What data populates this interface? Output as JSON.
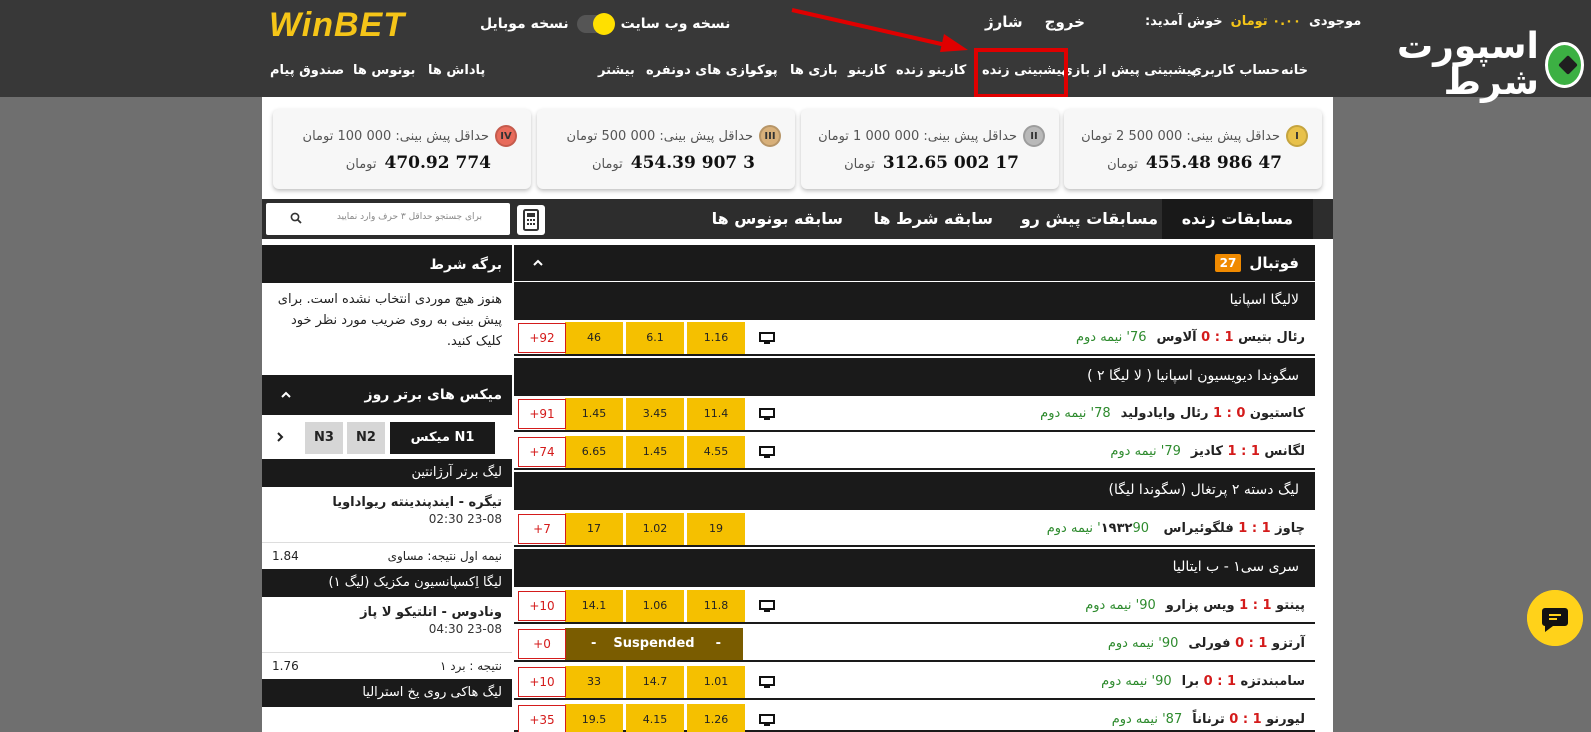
{
  "header": {
    "logo": "WinBET",
    "mobile_version": "نسخه موبایل",
    "web_version": "نسخه وب سایت",
    "logout": "خروج",
    "charge": "شارژ",
    "welcome": "خوش آمدید:",
    "balance_label": "موجودی",
    "balance_amount": "۰.۰۰ تومان",
    "brand_text": "اسپورت شرط"
  },
  "nav": [
    {
      "label": "خانه"
    },
    {
      "label": "حساب کاربری"
    },
    {
      "label": "پیشبینی پیش از بازی"
    },
    {
      "label": "پیشبینی زنده"
    },
    {
      "label": "کازینو زنده"
    },
    {
      "label": "کازینو"
    },
    {
      "label": "بازی ها"
    },
    {
      "label": "پوکر"
    },
    {
      "label": "بازی های دونفره"
    },
    {
      "label": "بیشتر"
    },
    {
      "label": "پاداش ها"
    },
    {
      "label": "بونوس ها"
    },
    {
      "label": "صندوق پیام"
    }
  ],
  "jackpots": [
    {
      "medal": "I",
      "medal_color": "#e8c14a",
      "min": "حداقل پیش بینی: 000 500 2 تومان",
      "amount": "47 986 455.48",
      "unit": "تومان"
    },
    {
      "medal": "II",
      "medal_color": "#b9b9b9",
      "min": "حداقل پیش بینی: 000 000 1 تومان",
      "amount": "17 002 312.65",
      "unit": "تومان"
    },
    {
      "medal": "III",
      "medal_color": "#d8b07a",
      "min": "حداقل پیش بینی: 000 500 تومان",
      "amount": "3 907 454.39",
      "unit": "تومان"
    },
    {
      "medal": "IV",
      "medal_color": "#e86b5b",
      "min": "حداقل پیش بینی: 000 100 تومان",
      "amount": "774 470.92",
      "unit": "تومان"
    }
  ],
  "tabs": {
    "live": "مسابقات زنده",
    "prematch": "مسابقات پیش رو",
    "bet_history": "سابقه شرط ها",
    "bonus_history": "سابقه بونوس ها"
  },
  "search": {
    "placeholder": "برای جستجو حداقل ۳ حرف وارد نمایید"
  },
  "betslip": {
    "title": "برگه شرط",
    "empty": "هنوز هیچ موردی انتخاب نشده است. برای پیش بینی به روی ضریب مورد نظر خود کلیک کنید."
  },
  "mix": {
    "title": "میکس های برتر روز",
    "tabs": [
      "میکس N1",
      "N2",
      "N3"
    ],
    "leagues": [
      {
        "name": "لیگ برتر آرژانتین",
        "event": "تیگره - ایندپندینته ریواداویا",
        "date": "23-08 02:30",
        "market": "نیمه اول نتیجه: مساوی",
        "odd": "1.84"
      },
      {
        "name": "لیگا اِکسپانسیون مکزیک (لیگ ۱)",
        "event": "ونادوس - اتلتیکو لا پاز",
        "date": "23-08 04:30",
        "market": "نتیجه : برد ۱",
        "odd": "1.76"
      },
      {
        "name": "لیگ هاکی روی یخ استرالیا"
      }
    ]
  },
  "sport": {
    "name": "فوتبال",
    "count": "27"
  },
  "leagues": [
    {
      "name": "لالیگا اسپانیا"
    },
    {
      "name": "سگوندا دیویسیون اسپانیا ( لا لیگا ۲ )"
    },
    {
      "name": "لیگ دسته ۲ پرتغال (سگوندا لیگا)"
    },
    {
      "name": "سری سی۱ - ب ایتالیا"
    }
  ],
  "matches": [
    {
      "home": "رئال بتیس",
      "hs": "1",
      "as": "0",
      "away": "آلاوس",
      "time": "76' نیمه دوم",
      "o1": "1.16",
      "ox": "6.1",
      "o2": "46",
      "more": "+92"
    },
    {
      "home": "کاستیون",
      "hs": "0",
      "as": "1",
      "away": "رئال وایادولید",
      "time": "78' نیمه دوم",
      "o1": "11.4",
      "ox": "3.45",
      "o2": "1.45",
      "more": "+91"
    },
    {
      "home": "لگانس",
      "hs": "1",
      "as": "1",
      "away": "کادیز",
      "time": "79' نیمه دوم",
      "o1": "4.55",
      "ox": "1.45",
      "o2": "6.65",
      "more": "+74"
    },
    {
      "home": "چاوز",
      "hs": "1",
      "as": "1",
      "away": "فلگوئیراس ۱۹۳۲",
      "time": "90' نیمه دوم",
      "o1": "19",
      "ox": "1.02",
      "o2": "17",
      "more": "+7"
    },
    {
      "home": "پینتو",
      "hs": "1",
      "as": "1",
      "away": "ویس پزارو",
      "time": "90' نیمه دوم",
      "o1": "11.8",
      "ox": "1.06",
      "o2": "14.1",
      "more": "+10"
    },
    {
      "home": "آرتزو",
      "hs": "1",
      "as": "0",
      "away": "فورلی",
      "time": "90' نیمه دوم",
      "o1": "-",
      "ox": "Suspended",
      "o2": "-",
      "more": "+0"
    },
    {
      "home": "سامبندتزه",
      "hs": "1",
      "as": "0",
      "away": "برا",
      "time": "90' نیمه دوم",
      "o1": "1.01",
      "ox": "14.7",
      "o2": "33",
      "more": "+10"
    },
    {
      "home": "لیورنو",
      "hs": "1",
      "as": "0",
      "away": "ترناناً",
      "time": "87' نیمه دوم",
      "o1": "1.26",
      "ox": "4.15",
      "o2": "19.5",
      "more": "+35"
    }
  ]
}
